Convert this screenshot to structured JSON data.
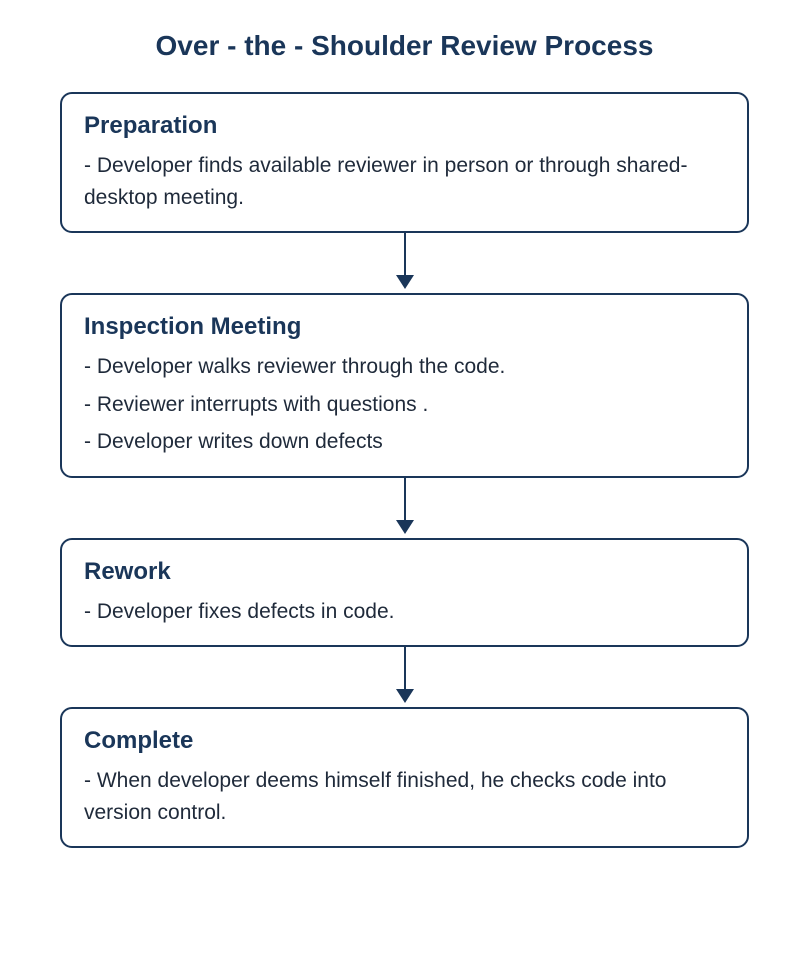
{
  "title": "Over - the - Shoulder Review Process",
  "colors": {
    "primary": "#1a3659",
    "text": "#1f2a3a"
  },
  "steps": [
    {
      "title": "Preparation",
      "items": [
        "- Developer finds available reviewer in person or through shared-desktop meeting."
      ]
    },
    {
      "title": "Inspection Meeting",
      "items": [
        "- Developer walks reviewer through the code.",
        "- Reviewer interrupts with questions .",
        "- Developer writes down defects"
      ]
    },
    {
      "title": "Rework",
      "items": [
        "- Developer fixes defects in code."
      ]
    },
    {
      "title": "Complete",
      "items": [
        "- When developer deems himself finished, he checks code into version control."
      ]
    }
  ]
}
